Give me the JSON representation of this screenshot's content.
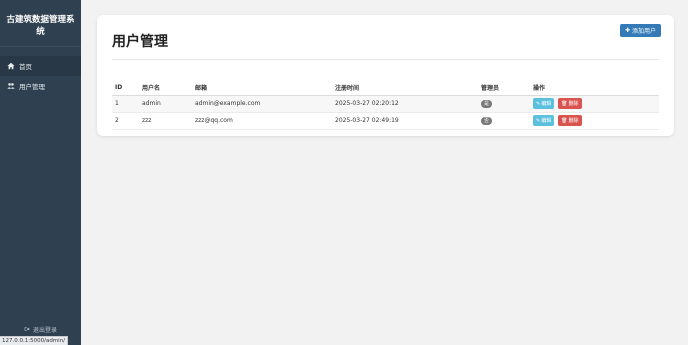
{
  "sidebar": {
    "title": "古建筑数据管理系统",
    "items": [
      {
        "label": "首页",
        "icon": "home-icon",
        "active": true
      },
      {
        "label": "用户管理",
        "icon": "users-icon",
        "active": false
      }
    ],
    "logout_label": "退出登录"
  },
  "status_url": "127.0.0.1:5000/admin/",
  "main": {
    "title": "用户管理",
    "add_button": "添加用户",
    "table": {
      "headers": [
        "ID",
        "用户名",
        "邮箱",
        "注册时间",
        "管理员",
        "操作"
      ],
      "rows": [
        {
          "id": "1",
          "username": "admin",
          "email": "admin@example.com",
          "registered": "2025-03-27 02:20:12",
          "admin": "是",
          "edit": "编辑",
          "delete": "删除"
        },
        {
          "id": "2",
          "username": "zzz",
          "email": "zzz@qq.com",
          "registered": "2025-03-27 02:49:19",
          "admin": "否",
          "edit": "编辑",
          "delete": "删除"
        }
      ]
    }
  },
  "colors": {
    "sidebar_bg": "#2f4050",
    "primary": "#337ab7",
    "edit": "#5bc0de",
    "delete": "#d9534f",
    "badge": "#777777"
  }
}
